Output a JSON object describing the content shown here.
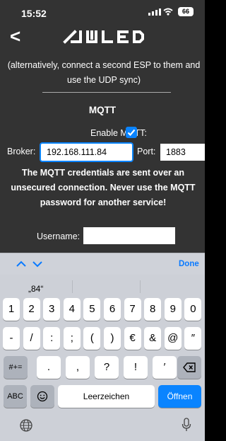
{
  "status": {
    "time": "15:52",
    "battery": "66"
  },
  "header": {
    "back_glyph": "<",
    "logo_alt": "WLED logo"
  },
  "content": {
    "note": "(alternatively, connect a second ESP to them and use the UDP sync)",
    "section_title": "MQTT",
    "enable_label": "Enable MQTT:",
    "enable_checked": true,
    "broker_label": "Broker:",
    "broker_value": "192.168.111.84",
    "port_label": "Port:",
    "port_value": "1883",
    "warning": "The MQTT credentials are sent over an unsecured connection. Never use the MQTT password for another service!",
    "username_label": "Username:",
    "username_value": ""
  },
  "keyboard": {
    "done_label": "Done",
    "suggestion": "„84“",
    "row1": [
      "1",
      "2",
      "3",
      "4",
      "5",
      "6",
      "7",
      "8",
      "9",
      "0"
    ],
    "row2": [
      "-",
      "/",
      ":",
      ";",
      "(",
      ")",
      "€",
      "&",
      "@",
      "″"
    ],
    "row3": [
      ".",
      ",",
      "?",
      "!",
      "′"
    ],
    "symbols_label": "#+=",
    "abc_label": "ABC",
    "space_label": "Leerzeichen",
    "open_label": "Öffnen",
    "icons": [
      "chevron-up-icon",
      "chevron-down-icon",
      "backspace-icon",
      "emoji-icon",
      "globe-icon",
      "microphone-icon"
    ],
    "accent_color": "#0a84ff"
  }
}
